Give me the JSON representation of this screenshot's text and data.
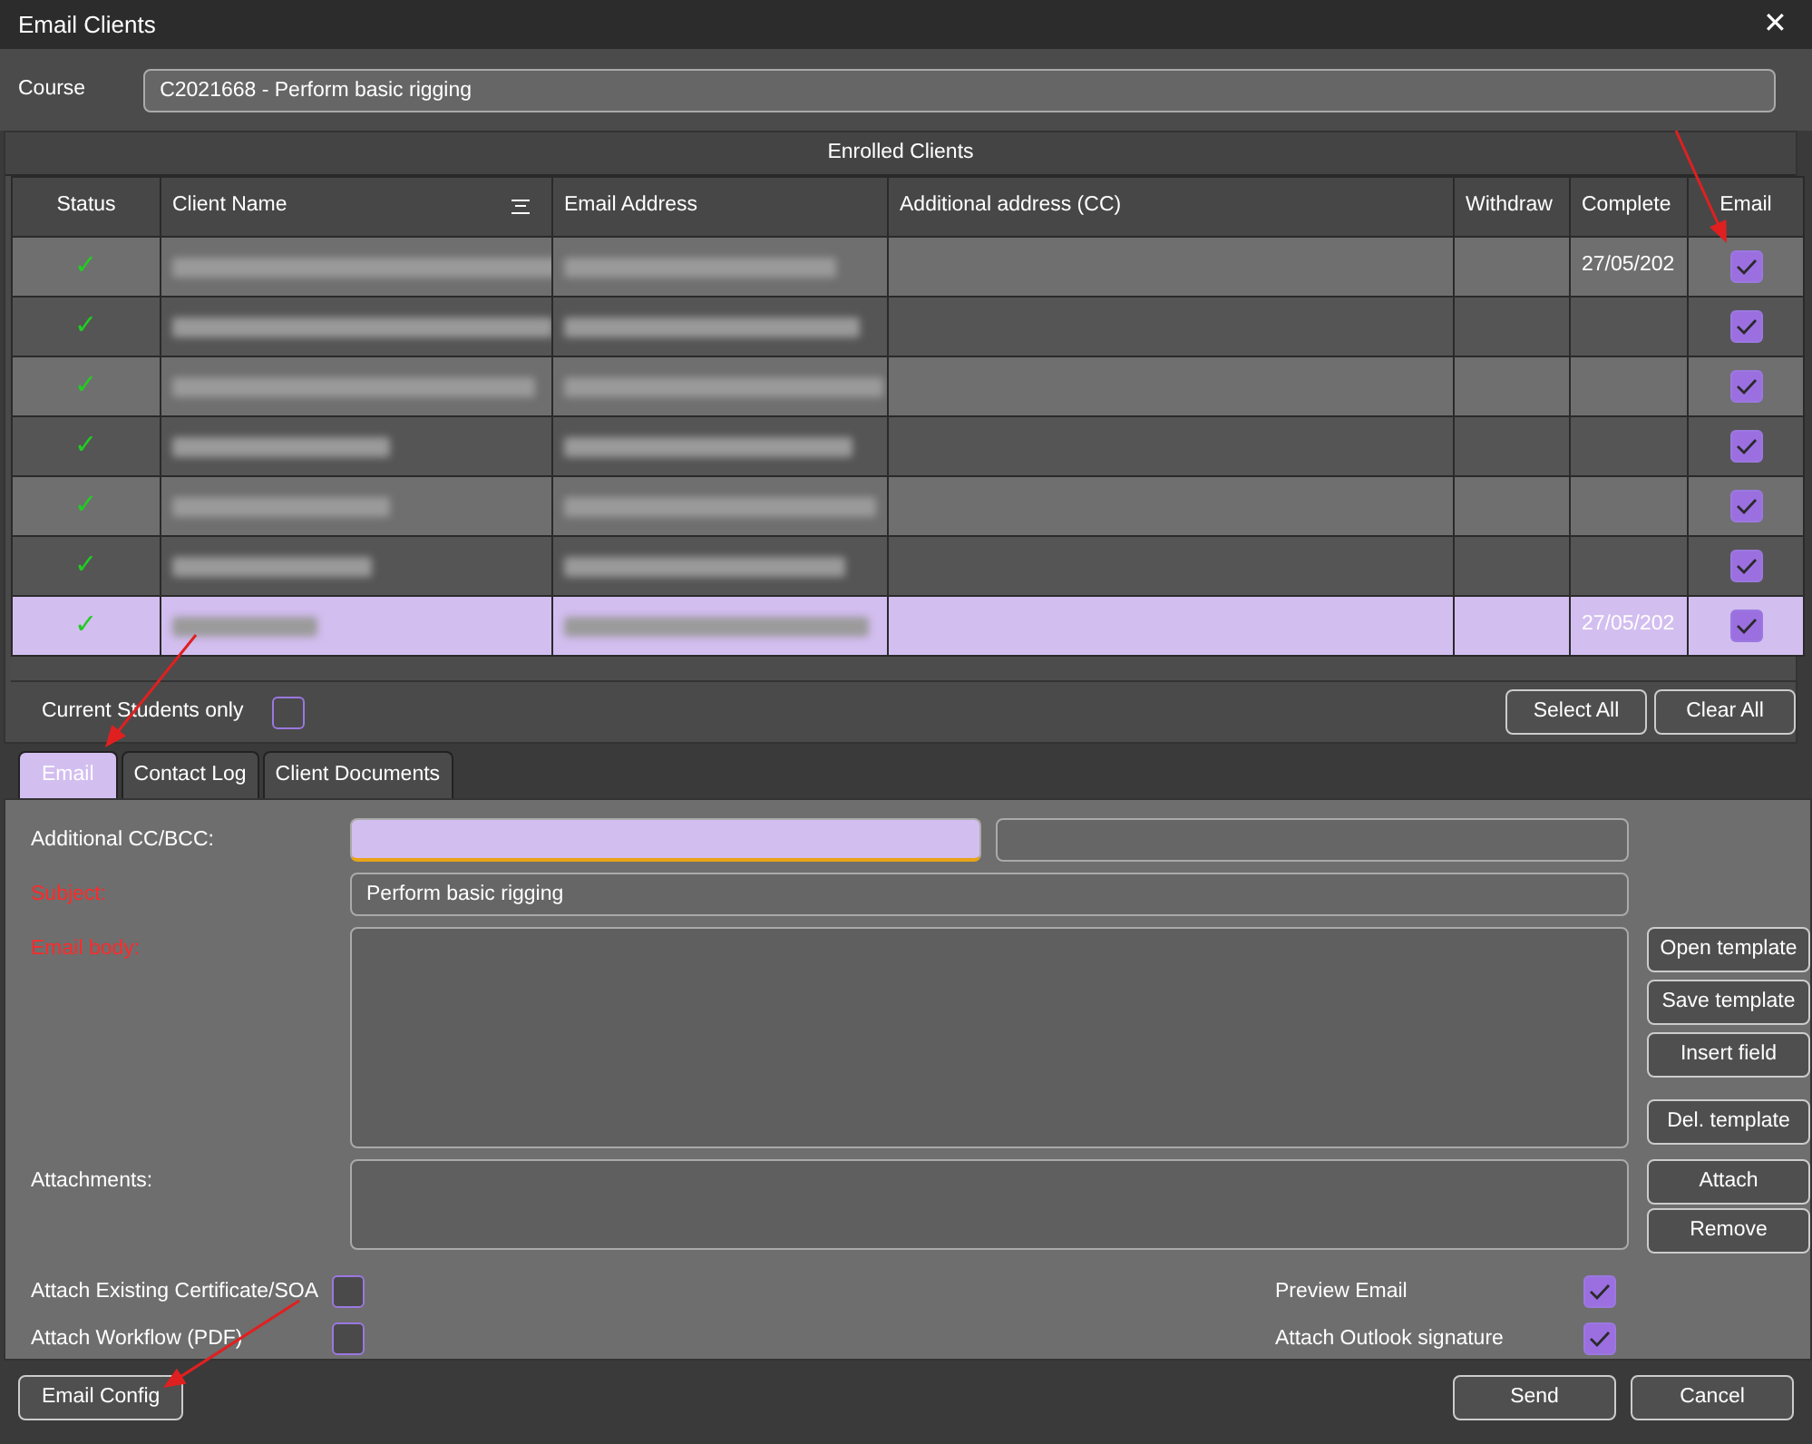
{
  "window": {
    "title": "Email Clients",
    "close": "✕"
  },
  "course": {
    "label": "Course",
    "value": "C2021668 - Perform basic rigging"
  },
  "enrolled": {
    "title": "Enrolled Clients",
    "columns": [
      {
        "label": "Status",
        "sorted": false
      },
      {
        "label": "Client Name",
        "sorted": true
      },
      {
        "label": "Email Address",
        "sorted": false
      },
      {
        "label": "Additional address (CC)",
        "sorted": false
      },
      {
        "label": "Withdraw",
        "sorted": false
      },
      {
        "label": "Complete",
        "sorted": false
      },
      {
        "label": "Email",
        "sorted": false
      }
    ],
    "rows": [
      {
        "status": "✓",
        "completed": "27/05/202",
        "email": true,
        "selected": false
      },
      {
        "status": "✓",
        "email": true,
        "selected": false
      },
      {
        "status": "✓",
        "email": true,
        "selected": false
      },
      {
        "status": "✓",
        "email": true,
        "selected": false
      },
      {
        "status": "✓",
        "email": true,
        "selected": false
      },
      {
        "status": "✓",
        "email": true,
        "selected": false
      },
      {
        "status": "✓",
        "completed": "27/05/202",
        "email": true,
        "selected": true
      }
    ],
    "current_only": {
      "label": "Current Students only",
      "checked": false
    },
    "buttons": [
      "Select All",
      "Clear All"
    ]
  },
  "tabs": [
    {
      "label": "Email",
      "selected": true
    },
    {
      "label": "Contact Log",
      "selected": false
    },
    {
      "label": "Client Documents",
      "selected": false
    }
  ],
  "form": {
    "cc_label": "Additional CC/BCC:",
    "subject_label": "Subject:",
    "subject": "Perform basic rigging",
    "body_label": "Email body:",
    "attachments_label": "Attachments:",
    "template_buttons": [
      "Open template",
      "Save template",
      "Insert field"
    ],
    "delete_button": "Del. template",
    "attach_buttons": [
      "Attach",
      "Remove"
    ],
    "options": [
      {
        "label": "Attach Existing Certificate/SOA",
        "checked": false
      },
      {
        "label": "Preview Email",
        "checked": true
      },
      {
        "label": "Attach Workflow (PDF)",
        "checked": false
      },
      {
        "label": "Attach Outlook signature",
        "checked": true
      }
    ]
  },
  "footer": {
    "config": "Email Config",
    "buttons": [
      "Send",
      "Cancel"
    ]
  },
  "annotation_arrows": [
    {
      "kind": "arrow"
    },
    {
      "kind": "arrow"
    },
    {
      "kind": "arrow"
    }
  ]
}
